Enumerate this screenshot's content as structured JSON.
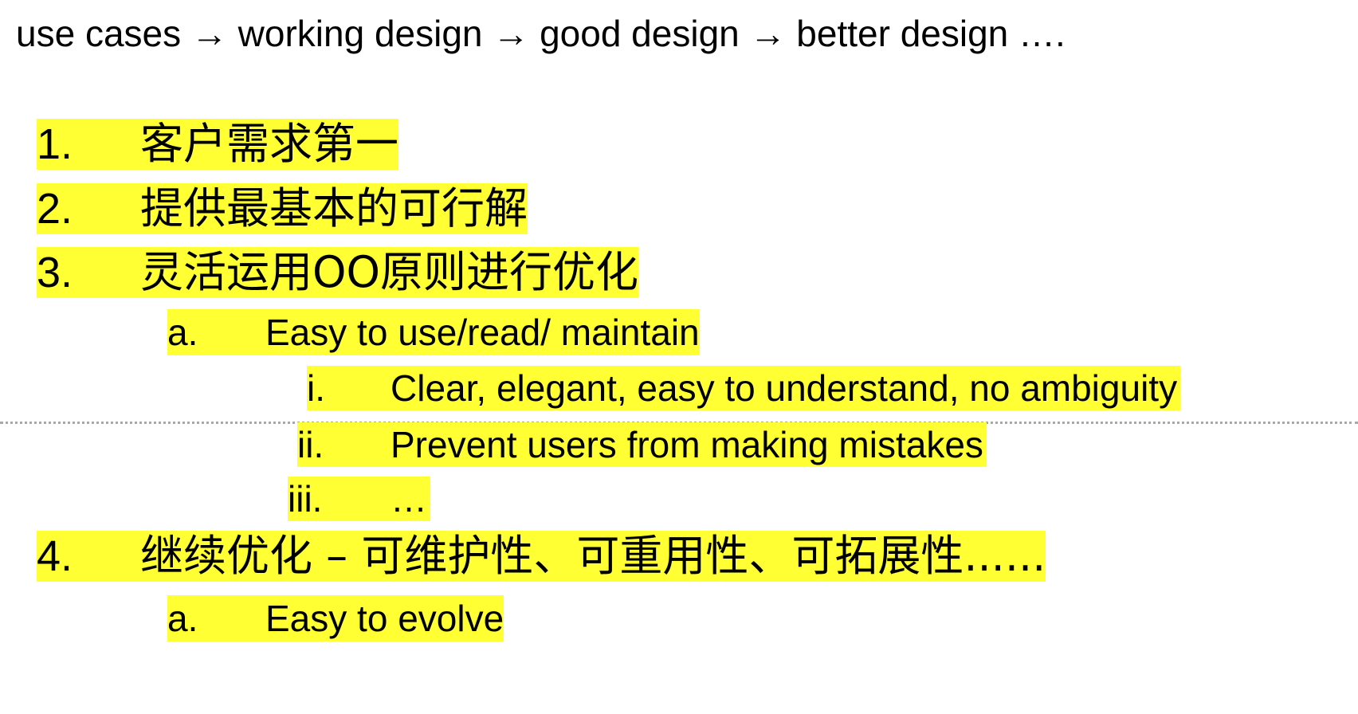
{
  "heading": "use cases → working design → good design → better design ….",
  "list": [
    {
      "marker": "1.",
      "text": "客户需求第一"
    },
    {
      "marker": "2.",
      "text": "提供最基本的可行解"
    },
    {
      "marker": "3.",
      "text": "灵活运用OO原则进行优化",
      "sub": [
        {
          "marker": "a.",
          "text": "Easy to use/read/ maintain",
          "sub": [
            {
              "marker": "i.",
              "text": "Clear, elegant, easy to understand, no ambiguity"
            },
            {
              "marker": "ii.",
              "text": "Prevent users from making mistakes"
            },
            {
              "marker": "iii.",
              "text": "…"
            }
          ]
        }
      ]
    },
    {
      "marker": "4.",
      "text": "继续优化 – 可维护性、可重用性、可拓展性......",
      "sub": [
        {
          "marker": "a.",
          "text": "Easy to evolve"
        }
      ]
    }
  ],
  "colors": {
    "highlight": "#ffff33",
    "divider": "#a8a8a8",
    "text": "#000000"
  }
}
